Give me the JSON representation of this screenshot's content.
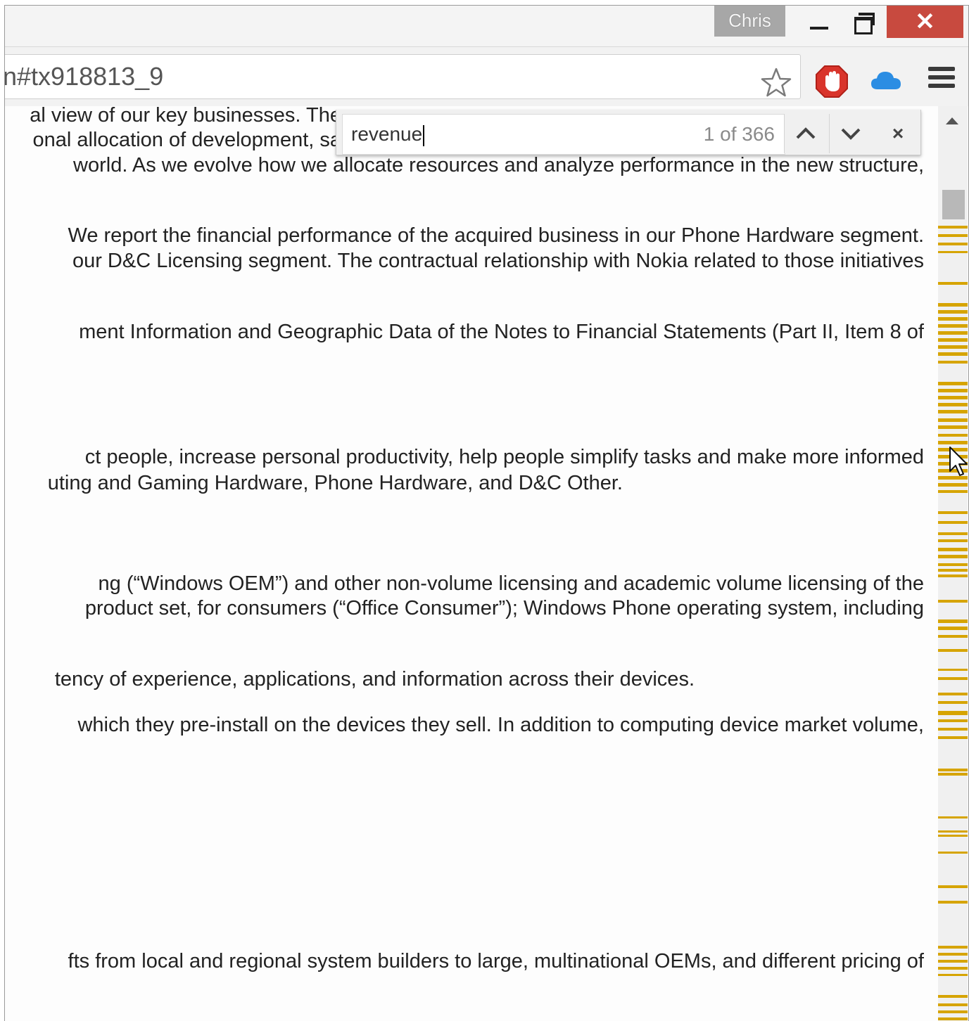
{
  "titlebar": {
    "user_name": "Chris",
    "close_glyph": "✕"
  },
  "omnibox": {
    "url_fragment": "n#tx918813_9",
    "icons": [
      "star-icon",
      "adblock-stop-icon",
      "cloud-icon",
      "menu-icon"
    ]
  },
  "find": {
    "query": "revenue",
    "count": "1 of 366",
    "close_glyph": "×"
  },
  "document": {
    "lines": [
      "al view of our key businesses. The",
      "onal allocation of development, sa",
      "world. As we evolve how we allocate resources and analyze performance in the new structure,",
      "We report the financial performance of the acquired business in our Phone Hardware segment.",
      "our D&C Licensing segment. The contractual relationship with Nokia related to those initiatives",
      "ment Information and Geographic Data of the Notes to Financial Statements (Part II, Item 8 of",
      "ct people, increase personal productivity, help people simplify tasks and make more informed",
      "uting and Gaming Hardware, Phone Hardware, and D&C Other.",
      "ng (“Windows OEM”) and other non-volume licensing and academic volume licensing of the",
      "product set, for consumers (“Office Consumer”); Windows Phone operating system, including",
      "tency of experience, applications, and information across their devices.",
      "which they pre-install on the devices they sell. In addition to computing device market volume,",
      "fts from local and regional system builders to large, multinational OEMs, and different pricing of"
    ]
  },
  "colors": {
    "match_marker": "#d6a400",
    "close_button": "#c84a3f",
    "user_badge": "#a7a7a7"
  }
}
